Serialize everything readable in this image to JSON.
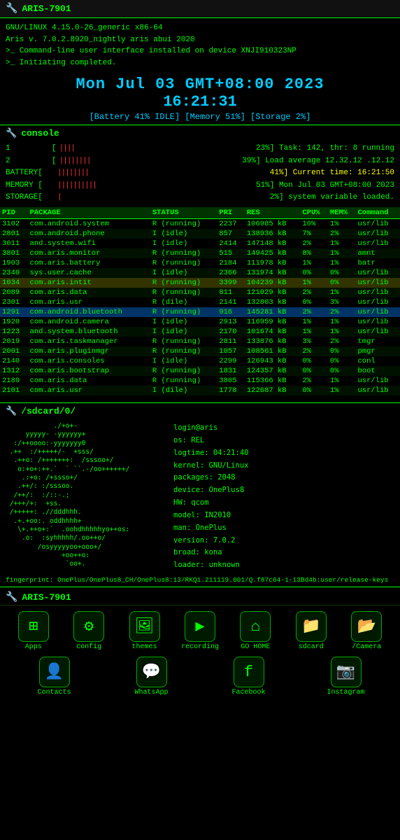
{
  "titleBar": {
    "icon": "🔧",
    "title": "ARIS-7901"
  },
  "topInfo": {
    "line1": "GNU/LINUX 4.15.0-26_generic x86-64",
    "line2": "Aris v. 7.0.2.8920_nightly aris abui 2020",
    "line3": ">_ Command-line user interface installed on device XNJI910323NP",
    "line4": ">_ Initiating completed."
  },
  "clock": {
    "date": "Mon Jul 03 GMT+08:00 2023",
    "time": "16:21:31",
    "stats": "[Battery 41% IDLE] [Memory 51%] [Storage 2%]"
  },
  "console": {
    "sectionLabel": "console",
    "rows": [
      {
        "label": "1",
        "bar": "||||",
        "pct": "23%",
        "desc": "Task: 142, thr: 8 running"
      },
      {
        "label": "2",
        "bar": "||||||||",
        "pct": "39%",
        "desc": "Load average 12.32.12 .12.12"
      },
      {
        "label": "BATTERY",
        "bar": "||||||||",
        "pct": "41%",
        "desc": "Current time: 16:21:50",
        "descColor": "yellow"
      },
      {
        "label": "MEMORY ",
        "bar": "||||||||||",
        "pct": "51%",
        "desc": "Mon Jul 03 GMT+08:00 2023"
      },
      {
        "label": "STORAGE",
        "bar": "|",
        "pct": "2%",
        "desc": "system variable loaded."
      }
    ]
  },
  "processTable": {
    "headers": [
      "PID",
      "PACKAGE",
      "STATUS",
      "PRI",
      "RES",
      "CPU%",
      "MEM%",
      "Command"
    ],
    "rows": [
      {
        "pid": "3102",
        "package": "com.android.system",
        "status": "R (running)",
        "pri": "2237",
        "res": "106985 kB",
        "cpu": "10%",
        "mem": "1%",
        "cmd": "usr/lib",
        "highlight": ""
      },
      {
        "pid": "2801",
        "package": "com.android.phone",
        "status": "I (idle)",
        "pri": "857",
        "res": "138936 kB",
        "cpu": "7%",
        "mem": "2%",
        "cmd": "usr/lib",
        "highlight": ""
      },
      {
        "pid": "3011",
        "package": "and.system.wifi",
        "status": "I (idle)",
        "pri": "2414",
        "res": "147148 kB",
        "cpu": "2%",
        "mem": "1%",
        "cmd": "usr/lib",
        "highlight": ""
      },
      {
        "pid": "3801",
        "package": "com.aris.monitor",
        "status": "R (running)",
        "pri": "515",
        "res": "149425 kB",
        "cpu": "8%",
        "mem": "1%",
        "cmd": "amnt",
        "highlight": ""
      },
      {
        "pid": "1903",
        "package": "com.aris.battery",
        "status": "R (running)",
        "pri": "2184",
        "res": "111978 kB",
        "cpu": "1%",
        "mem": "1%",
        "cmd": "batr",
        "highlight": ""
      },
      {
        "pid": "2340",
        "package": "sys.user.cache",
        "status": "I (idle)",
        "pri": "2366",
        "res": "131974 kB",
        "cpu": "0%",
        "mem": "0%",
        "cmd": "usr/lib",
        "highlight": ""
      },
      {
        "pid": "1034",
        "package": "com.aris.intit",
        "status": "R (running)",
        "pri": "3399",
        "res": "104239 kB",
        "cpu": "1%",
        "mem": "0%",
        "cmd": "usr/lib",
        "highlight": "yellow"
      },
      {
        "pid": "2089",
        "package": "com.aris.data",
        "status": "R (running)",
        "pri": "811",
        "res": "121029 kB",
        "cpu": "2%",
        "mem": "1%",
        "cmd": "usr/lib",
        "highlight": ""
      },
      {
        "pid": "2301",
        "package": "com.aris.usr",
        "status": "R (dile)",
        "pri": "2141",
        "res": "132803 kB",
        "cpu": "0%",
        "mem": "3%",
        "cmd": "usr/lib",
        "highlight": ""
      },
      {
        "pid": "1291",
        "package": "com.android.bluetooth",
        "status": "R (running)",
        "pri": "916",
        "res": "145281 kB",
        "cpu": "2%",
        "mem": "2%",
        "cmd": "usr/lib",
        "highlight": "blue"
      },
      {
        "pid": "1920",
        "package": "com.android.camera",
        "status": "I (idle)",
        "pri": "2913",
        "res": "116959 kB",
        "cpu": "1%",
        "mem": "1%",
        "cmd": "usr/lib",
        "highlight": ""
      },
      {
        "pid": "1223",
        "package": "and.system.bluetooth",
        "status": "I (idle)",
        "pri": "2170",
        "res": "101674 kB",
        "cpu": "1%",
        "mem": "1%",
        "cmd": "usr/lib",
        "highlight": ""
      },
      {
        "pid": "2019",
        "package": "com.aris.taskmanager",
        "status": "R (running)",
        "pri": "2811",
        "res": "133876 kB",
        "cpu": "3%",
        "mem": "2%",
        "cmd": "tmgr",
        "highlight": ""
      },
      {
        "pid": "2001",
        "package": "com.aris.pluginmgr",
        "status": "R (running)",
        "pri": "1057",
        "res": "108561 kB",
        "cpu": "2%",
        "mem": "0%",
        "cmd": "pmgr",
        "highlight": ""
      },
      {
        "pid": "2140",
        "package": "com.aris.consoles",
        "status": "I (idle)",
        "pri": "2299",
        "res": "126943 kB",
        "cpu": "0%",
        "mem": "0%",
        "cmd": "conl",
        "highlight": ""
      },
      {
        "pid": "1312",
        "package": "com.aris.bootstrap",
        "status": "R (running)",
        "pri": "1831",
        "res": "124357 kB",
        "cpu": "0%",
        "mem": "0%",
        "cmd": "boot",
        "highlight": ""
      },
      {
        "pid": "2189",
        "package": "com.aris.data",
        "status": "R (running)",
        "pri": "3805",
        "res": "115366 kB",
        "cpu": "2%",
        "mem": "1%",
        "cmd": "usr/lib",
        "highlight": ""
      },
      {
        "pid": "2101",
        "package": "com.aris.usr",
        "status": "I (dile)",
        "pri": "1778",
        "res": "122687 kB",
        "cpu": "0%",
        "mem": "1%",
        "cmd": "usr/lib",
        "highlight": ""
      }
    ]
  },
  "sdcard": {
    "sectionLabel": "/sdcard/0/",
    "asciiArt": "            ./+o+-\n     yyyyy- -yyyyyy+\n  :/++oooo:-yyyyyyy0\n .++  :/+++++/-  +sss/\n  .++o: /+++++++:  /sssoo+/\n   o:+o+:++.`  ` ``.-/oo++++++/\n    .:+o: /+ssso+/\n   .++/: :/sssoo.\n  /++/:  :/::-.;\n /+++/+:  +ss.\n /+++++: .//dddhhh.\n  .+.+oo:. oddhhhh+\n   \\+.++o+:`  .oohdhhhhhyo++os:\n    .o:  :syhhhhh/.oo++o/\n        /osyyyyyoo+ooo+/\n              +oo++o:\n               `oo+.",
    "systemInfo": "login@aris\nos: REL\nlogtime: 04:21:40\nkernel: GNU/Linux\npackages: 2048\ndevice: OnePlus8\nHW: qcom\nmodel: IN2010\nman: OnePlus\nversion: 7.0.2\nbroad: kona\nloader: unknown"
  },
  "fingerprint": {
    "text": "fingerprint: OnePlus/OnePlus8_CH/OnePlus8:13/RKQ1.211119.001/Q.f87c64-1-13Bd4b:user/release-keys"
  },
  "bottomTitleBar": {
    "icon": "🔧",
    "title": "ARIS-7901"
  },
  "dock": {
    "row1": [
      {
        "name": "Apps",
        "icon": "⊞",
        "id": "apps"
      },
      {
        "name": "config",
        "icon": "⚙",
        "id": "config"
      },
      {
        "name": "themes",
        "icon": "🖼",
        "id": "themes"
      },
      {
        "name": "recording",
        "icon": "▶",
        "id": "recording"
      },
      {
        "name": "GO HOME",
        "icon": "⌂",
        "id": "go-home"
      },
      {
        "name": "sdcard",
        "icon": "📁",
        "id": "sdcard"
      },
      {
        "name": "/Camera",
        "icon": "📂",
        "id": "camera"
      }
    ],
    "row2": [
      {
        "name": "Contacts",
        "icon": "👤",
        "id": "contacts"
      },
      {
        "name": "WhatsApp",
        "icon": "💬",
        "id": "whatsapp"
      },
      {
        "name": "Facebook",
        "icon": "f",
        "id": "facebook"
      },
      {
        "name": "Instagram",
        "icon": "📷",
        "id": "instagram"
      }
    ]
  }
}
